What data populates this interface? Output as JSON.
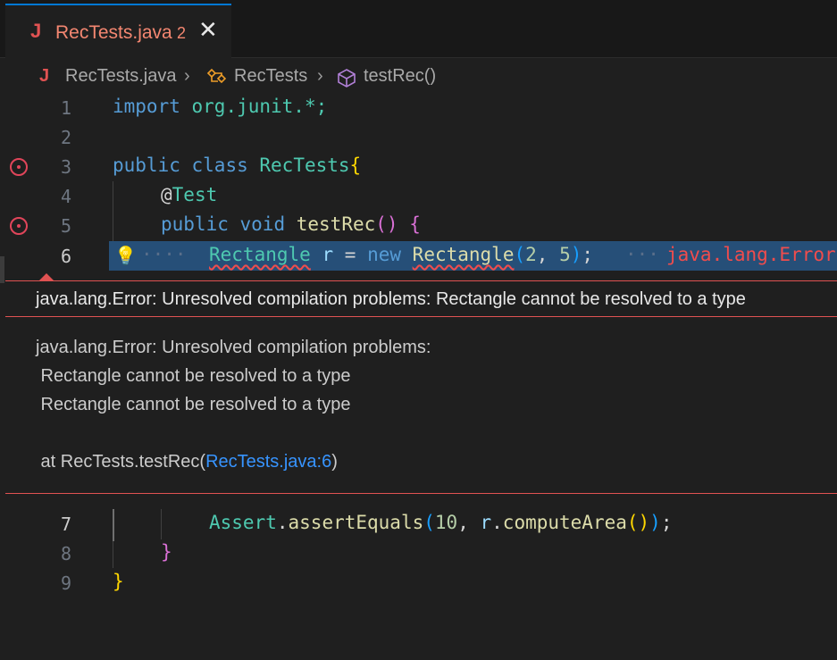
{
  "tab": {
    "icon_letter": "J",
    "file_name": "RecTests.java",
    "problem_count": "2",
    "close_glyph": "✕"
  },
  "breadcrumb": {
    "file": "RecTests.java",
    "class": "RecTests",
    "method": "testRec()"
  },
  "editor": {
    "line_numbers": [
      "1",
      "2",
      "3",
      "4",
      "5",
      "6",
      "7",
      "8",
      "9"
    ],
    "line1": {
      "kw": "import",
      "rest": "org.junit.*;"
    },
    "line3": {
      "kw1": "public",
      "kw2": "class",
      "name": "RecTests",
      "brace": "{"
    },
    "line4": {
      "at": "@",
      "ann": "Test"
    },
    "line5": {
      "kw1": "public",
      "kw2": "void",
      "name": "testRec",
      "parens": "()",
      "brace": "{"
    },
    "line6": {
      "type": "Rectangle",
      "var": "r",
      "eq": "=",
      "kw": "new",
      "ctor": "Rectangle",
      "open": "(",
      "a1": "2",
      "comma": ", ",
      "a2": "5",
      "close": ")",
      "semi": ";",
      "inline_error": "java.lang.Error"
    },
    "line7": {
      "cls": "Assert",
      "dot": ".",
      "method": "assertEquals",
      "open": "(",
      "num": "10",
      "comma": ", ",
      "var": "r",
      "dot2": ".",
      "call": "computeArea",
      "inner": "()",
      "close": ")",
      "semi": ";"
    },
    "line8": {
      "brace": "}"
    },
    "line9": {
      "brace": "}"
    }
  },
  "peek": {
    "title": "java.lang.Error: Unresolved compilation problems: Rectangle cannot be resolved to a type",
    "body_line1": "java.lang.Error: Unresolved compilation problems:",
    "body_line2": " Rectangle cannot be resolved to a type",
    "body_line3": " Rectangle cannot be resolved to a type",
    "stack_prefix": " at RecTests.testRec(",
    "stack_link": "RecTests.java:6",
    "stack_suffix": ")"
  },
  "colors": {
    "error": "#f14c4c",
    "selection": "#264f78",
    "accent": "#0078d4"
  }
}
